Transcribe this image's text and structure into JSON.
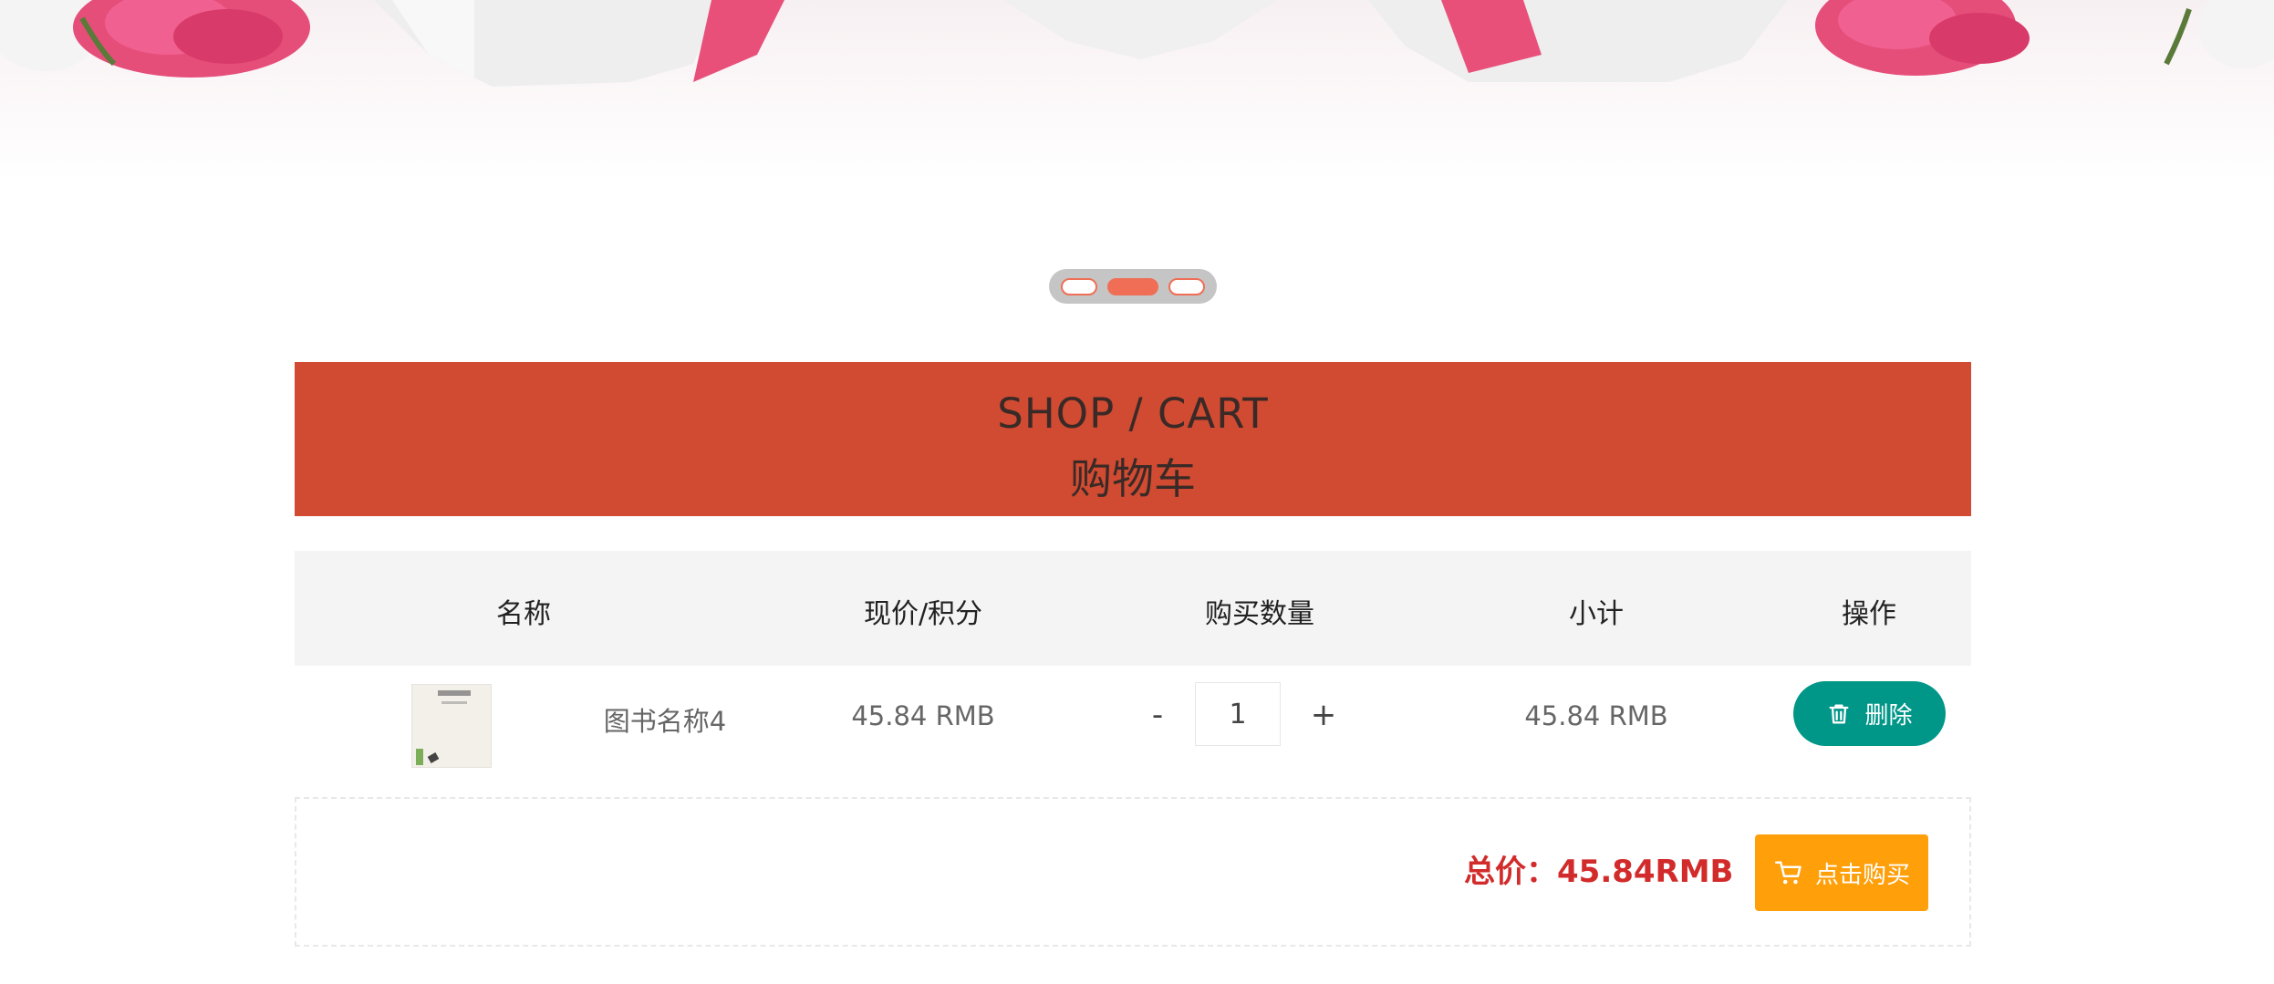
{
  "banner": {
    "image": "roses-and-gift-boxes"
  },
  "carousel": {
    "dots": 3,
    "active_index": 1,
    "accent": "#f06e55"
  },
  "title": {
    "en": "SHOP / CART",
    "cn": "购物车",
    "bg_color": "#d04b31"
  },
  "table": {
    "headers": [
      "名称",
      "现价/积分",
      "购买数量",
      "小计",
      "操作"
    ],
    "rows": [
      {
        "name": "图书名称4",
        "price": "45.84 RMB",
        "quantity": "1",
        "minus": "-",
        "plus": "+",
        "subtotal": "45.84 RMB",
        "delete_label": "删除"
      }
    ]
  },
  "footer": {
    "total_label": "总价：45.84RMB",
    "buy_label": "点击购买",
    "total_color": "#d22b2b",
    "buy_color": "#ff9f0a"
  },
  "icons": {
    "delete": "trash-icon",
    "buy": "cart-icon"
  }
}
